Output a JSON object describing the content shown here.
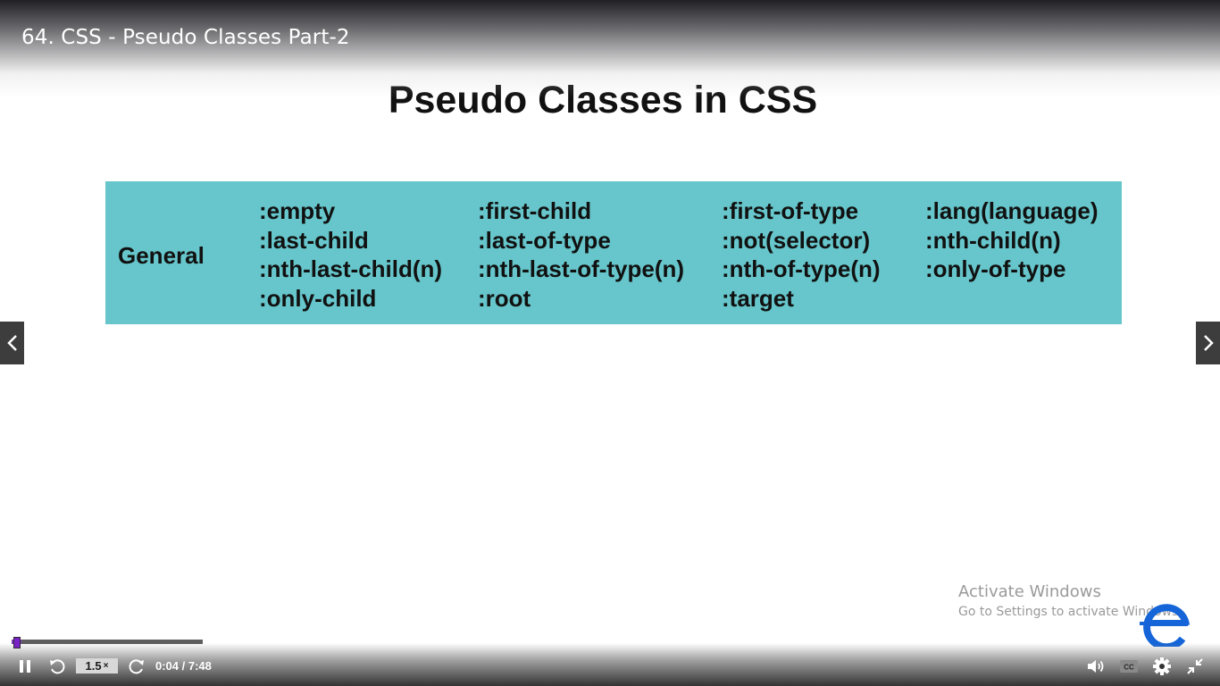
{
  "video": {
    "title": "64. CSS - Pseudo Classes Part-2"
  },
  "slide": {
    "title": "Pseudo Classes in CSS",
    "category": "General",
    "columns": [
      [
        ":empty",
        ":last-child",
        ":nth-last-child(n)",
        ":only-child"
      ],
      [
        ":first-child",
        ":last-of-type",
        ":nth-last-of-type(n)",
        ":root"
      ],
      [
        ":first-of-type",
        ":not(selector)",
        ":nth-of-type(n)",
        ":target"
      ],
      [
        ":lang(language)",
        ":nth-child(n)",
        ":only-of-type"
      ]
    ],
    "table_color": "#66c6cb"
  },
  "controls": {
    "speed_value": "1.5",
    "speed_suffix": "×",
    "time": "0:04 / 7:48",
    "progress_fraction": 0.0085,
    "buffered_fraction": 0.46,
    "accent": "#7a22c8",
    "icons": [
      "pause-icon",
      "rewind-icon",
      "forward-icon",
      "volume-icon",
      "captions-icon",
      "settings-icon",
      "exit-fullscreen-icon"
    ]
  },
  "navigation": {
    "prev_icon": "chevron-left-icon",
    "next_icon": "chevron-right-icon"
  },
  "watermark": {
    "title": "Activate Windows",
    "subtitle": "Go to Settings to activate Windows."
  }
}
